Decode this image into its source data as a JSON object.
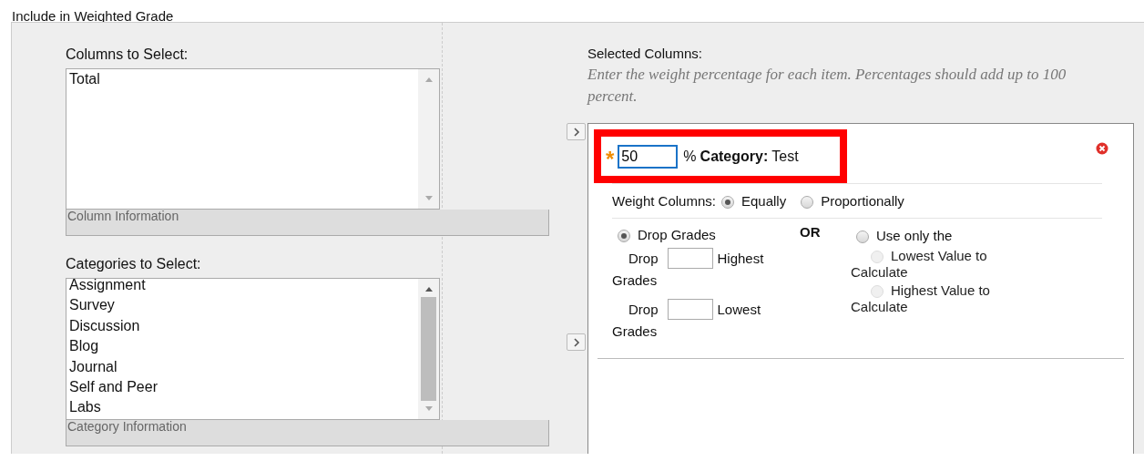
{
  "section_title": "Include in Weighted Grade",
  "columns_list": {
    "label": "Columns to Select:",
    "items": [
      "Total"
    ],
    "info": "Column Information"
  },
  "categories_list": {
    "label": "Categories to Select:",
    "items": [
      "Assignment",
      "Survey",
      "Discussion",
      "Blog",
      "Journal",
      "Self and Peer",
      "Labs"
    ],
    "info": "Category Information"
  },
  "selected": {
    "label": "Selected Columns:",
    "hint": "Enter the weight percentage for each item. Percentages should add up to 100 percent.",
    "item": {
      "required_mark": "*",
      "weight": "50",
      "percent": "%",
      "category_label": "Category:",
      "category": "Test",
      "highlighted": true,
      "weight_columns": {
        "label": "Weight Columns:",
        "options": [
          {
            "label": "Equally",
            "selected": true
          },
          {
            "label": "Proportionally",
            "selected": false
          }
        ]
      },
      "drop": {
        "label": "Drop Grades",
        "selected": true,
        "rows": [
          {
            "prefix": "Drop",
            "value": "",
            "suffix": "Highest",
            "wrap": "Grades"
          },
          {
            "prefix": "Drop",
            "value": "",
            "suffix": "Lowest",
            "wrap": "Grades"
          }
        ]
      },
      "or": "OR",
      "use_only": {
        "label": "Use only the",
        "selected": false,
        "options": [
          {
            "line1": "Lowest Value to",
            "line2": "Calculate",
            "selected": false,
            "disabled": true
          },
          {
            "line1": "Highest Value to",
            "line2": "Calculate",
            "selected": false,
            "disabled": true
          }
        ]
      }
    }
  }
}
